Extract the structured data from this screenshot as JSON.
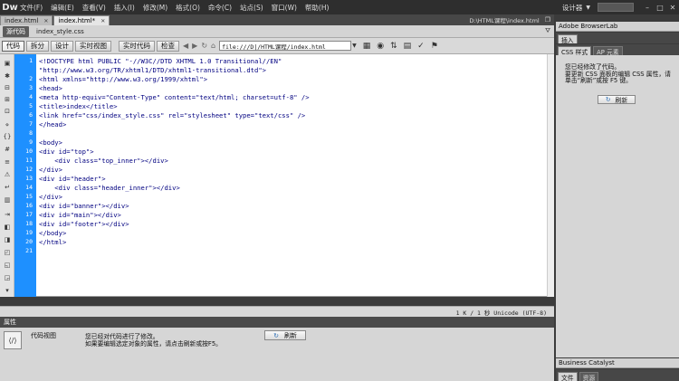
{
  "app": {
    "logo": "Dw",
    "menu": [
      "文件(F)",
      "编辑(E)",
      "查看(V)",
      "插入(I)",
      "修改(M)",
      "格式(O)",
      "命令(C)",
      "站点(S)",
      "窗口(W)",
      "帮助(H)"
    ],
    "workspace": "设计器",
    "window_buttons": [
      "–",
      "□",
      "✕"
    ]
  },
  "tabs": [
    {
      "label": "index.html",
      "active": false
    },
    {
      "label": "index.html*",
      "active": true
    }
  ],
  "doc_path": "D:\\HTML课程\\index.html",
  "related": {
    "source_code": "源代码",
    "file": "index_style.css"
  },
  "toolbar": {
    "code": "代码",
    "split": "拆分",
    "design": "设计",
    "live_code": "实时视图",
    "live_view": "实时代码",
    "inspect": "检查",
    "address": "file:///D|/HTML课程/index.html"
  },
  "editor": {
    "line_numbers": [
      "1",
      "2",
      "3",
      "4",
      "5",
      "6",
      "7",
      "8",
      "9",
      "10",
      "11",
      "12",
      "13",
      "14",
      "15",
      "16",
      "17",
      "18",
      "19",
      "20",
      "21"
    ],
    "lines": [
      "<!DOCTYPE html PUBLIC \"-//W3C//DTD XHTML 1.0 Transitional//EN\"",
      "\"http://www.w3.org/TR/xhtml1/DTD/xhtml1-transitional.dtd\">",
      "<html xmlns=\"http://www.w3.org/1999/xhtml\">",
      "<head>",
      "<meta http-equiv=\"Content-Type\" content=\"text/html; charset=utf-8\" />",
      "<title>index</title>",
      "<link href=\"css/index_style.css\" rel=\"stylesheet\" type=\"text/css\" />",
      "</head>",
      "",
      "<body>",
      "<div id=\"top\">",
      "    <div class=\"top_inner\"></div>",
      "</div>",
      "<div id=\"header\">",
      "    <div class=\"header_inner\"></div>",
      "</div>",
      "<div id=\"banner\"></div>",
      "<div id=\"main\"></div>",
      "<div id=\"footer\"></div>",
      "</body>",
      "</html>",
      ""
    ]
  },
  "status": "1 K / 1 秒 Unicode (UTF-8)",
  "properties": {
    "title": "属性",
    "view_label": "代码视图",
    "message_line1": "您已经对代码进行了修改。",
    "message_line2": "如果要编辑选定对象的属性，请点击刷新或按F5。",
    "refresh": "刷新"
  },
  "right_panel": {
    "browserlab": "Adobe BrowserLab",
    "insert_tab": "插入",
    "css_tab": "CSS 样式",
    "ap_tab": "AP 元素",
    "css_message": "您已经修改了代码。\n要更新 CSS 面板的编辑 CSS 属性，请单击“刷新”或按 F5 键。",
    "refresh": "刷新",
    "bc": "Business Catalyst",
    "files_tab": "文件",
    "assets_tab": "资源"
  }
}
